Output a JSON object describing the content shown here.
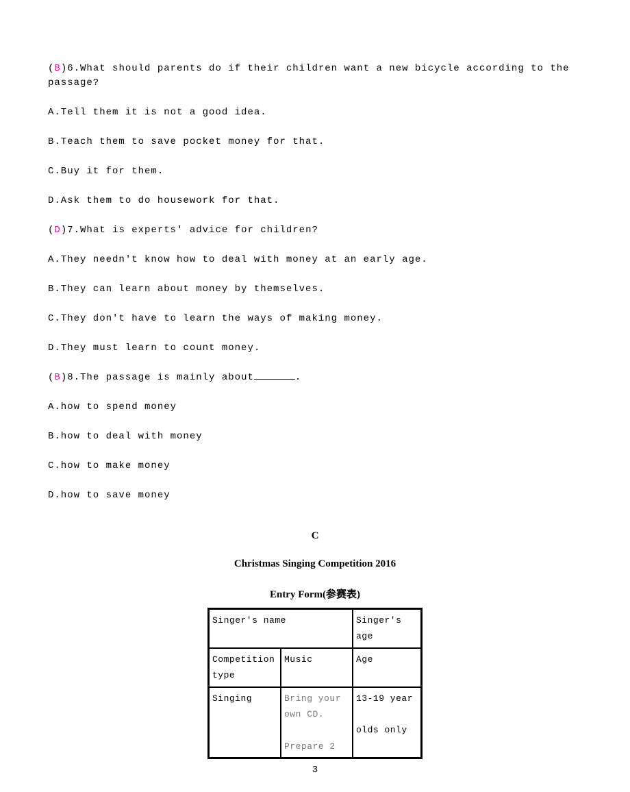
{
  "q6": {
    "answer": "B",
    "number": "6.",
    "text": "What should parents do if their children want a new bicycle according to the passage?",
    "options": {
      "A": "A.Tell them it is not a good idea.",
      "B": "B.Teach them to save pocket money for that.",
      "C": "C.Buy it for them.",
      "D": "D.Ask them to do housework for that."
    }
  },
  "q7": {
    "answer": "D",
    "number": "7.",
    "text": "What is experts'  advice for children?",
    "options": {
      "A": "A.They needn't know how to deal with money at an early age.",
      "B": "B.They can learn about money by themselves.",
      "C": "C.They don't have to learn the ways of making money.",
      "D": "D.They must learn to count money."
    }
  },
  "q8": {
    "answer": "B",
    "number": "8.",
    "text_before": "The passage is mainly about",
    "text_after": ".",
    "options": {
      "A": "A.how to spend money",
      "B": "B.how to deal with money",
      "C": "C.how to make money",
      "D": "D.how to save money"
    }
  },
  "section": {
    "letter": "C",
    "title": "Christmas Singing Competition 2016",
    "subtitle": "Entry Form(参赛表)"
  },
  "table": {
    "r1c1": "Singer's name",
    "r1c2": "Singer's age",
    "r2c1": "Competition type",
    "r2c2": "Music",
    "r2c3": "Age",
    "r3c1": "Singing",
    "r3c2a": "Bring your own CD.",
    "r3c2b": "Prepare 2",
    "r3c3a": "13-19 year",
    "r3c3b": "olds only"
  },
  "page_number": "3"
}
